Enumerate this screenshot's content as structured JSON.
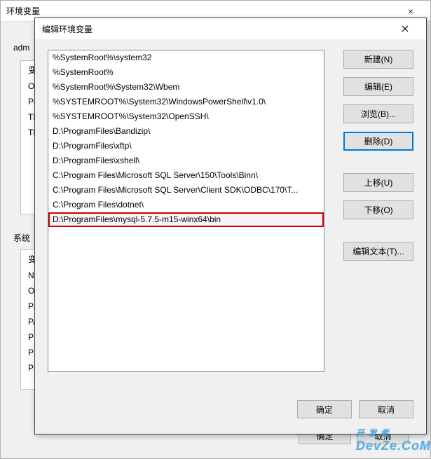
{
  "outer": {
    "title": "环境变量",
    "close": "×",
    "userSectionLabel": "adm",
    "systemSectionLabel": "系统",
    "userVars": [
      "变",
      "O",
      "Pa",
      "TE",
      "TN"
    ],
    "sysVars": [
      "变",
      "N",
      "O",
      "Pa",
      "PA",
      "PH",
      "PR",
      "PR"
    ],
    "okLabel": "确定",
    "cancelLabel": "取消"
  },
  "inner": {
    "title": "编辑环境变量",
    "close": "×",
    "paths": [
      "%SystemRoot%\\system32",
      "%SystemRoot%",
      "%SystemRoot%\\System32\\Wbem",
      "%SYSTEMROOT%\\System32\\WindowsPowerShell\\v1.0\\",
      "%SYSTEMROOT%\\System32\\OpenSSH\\",
      "D:\\ProgramFiles\\Bandizip\\",
      "D:\\ProgramFiles\\xftp\\",
      "D:\\ProgramFiles\\xshell\\",
      "C:\\Program Files\\Microsoft SQL Server\\150\\Tools\\Binn\\",
      "C:\\Program Files\\Microsoft SQL Server\\Client SDK\\ODBC\\170\\T...",
      "C:\\Program Files\\dotnet\\",
      "D:\\ProgramFiles\\mysql-5.7.5-m15-winx64\\bin"
    ],
    "selectedIndex": 11,
    "buttons": {
      "new": "新建(N)",
      "edit": "编辑(E)",
      "browse": "浏览(B)...",
      "delete": "删除(D)",
      "moveUp": "上移(U)",
      "moveDown": "下移(O)",
      "editText": "编辑文本(T)..."
    },
    "okLabel": "确定",
    "cancelLabel": "取消"
  },
  "watermark": {
    "line1": "开 发 者",
    "line2": "DevZe.CoM"
  }
}
